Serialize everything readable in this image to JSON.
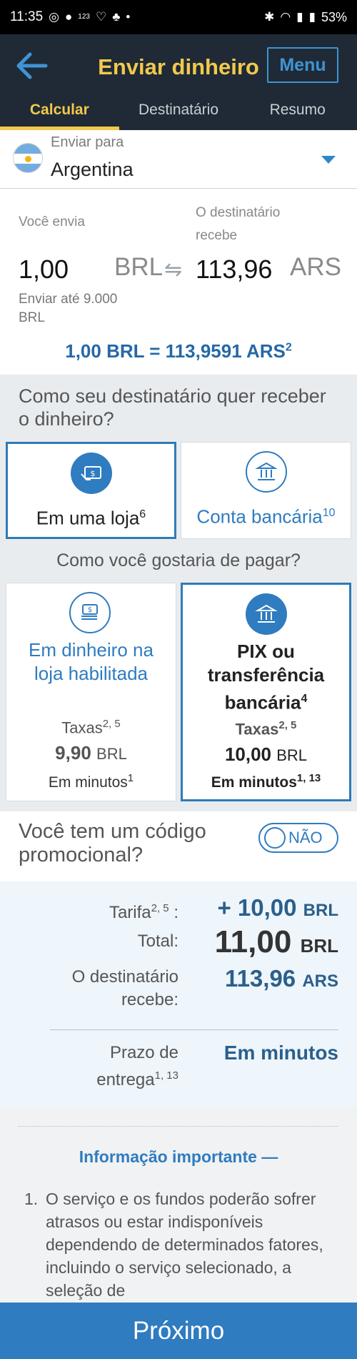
{
  "status_bar": {
    "time": "11:35",
    "hd_label": "123",
    "battery": "53%"
  },
  "header": {
    "title": "Enviar dinheiro",
    "menu_label": "Menu",
    "tabs": [
      {
        "label": "Calcular",
        "active": true
      },
      {
        "label": "Destinatário",
        "active": false
      },
      {
        "label": "Resumo",
        "active": false
      }
    ]
  },
  "country": {
    "label": "Enviar para",
    "value": "Argentina"
  },
  "amounts": {
    "send_label": "Você envia",
    "receive_label": "O destinatário recebe",
    "send_amount": "1,00",
    "send_currency": "BRL",
    "receive_amount": "113,96",
    "receive_currency": "ARS",
    "limit_text": "Enviar até  9.000 BRL",
    "rate_main": "1,00 BRL = 113,9591 ARS",
    "rate_sup": "2"
  },
  "receive_method": {
    "question": "Como seu destinatário quer receber o dinheiro?",
    "options": [
      {
        "label": "Em uma loja",
        "sup": "6",
        "selected": true,
        "icon": "cash-pickup-icon"
      },
      {
        "label": "Conta bancária",
        "sup": "10",
        "selected": false,
        "icon": "bank-icon"
      }
    ]
  },
  "pay_method": {
    "question": "Como você gostaria de pagar?",
    "options": [
      {
        "title": "Em dinheiro na loja habilitada",
        "title_sup": "",
        "fees_label": "Taxas",
        "fees_sup": "2, 5",
        "fee_amount": "9,90",
        "fee_currency": "BRL",
        "time": "Em minutos",
        "time_sup": "1",
        "selected": false,
        "icon": "cash-icon"
      },
      {
        "title": "PIX ou transferência bancária",
        "title_sup": "4",
        "fees_label": "Taxas",
        "fees_sup": "2, 5",
        "fee_amount": "10,00",
        "fee_currency": "BRL",
        "time": "Em minutos",
        "time_sup": "1, 13",
        "selected": true,
        "icon": "bank-icon"
      }
    ]
  },
  "promo": {
    "question": "Você tem um código promocional?",
    "toggle_label": "NÃO",
    "toggle_on": false
  },
  "summary": {
    "tarifa_label": "Tarifa",
    "tarifa_sup": "2, 5",
    "tarifa_colon": ":",
    "tarifa_value": "+ 10,00",
    "tarifa_currency": "BRL",
    "total_label": "Total:",
    "total_value": "11,00",
    "total_currency": "BRL",
    "receives_label": "O destinatário recebe:",
    "receives_value": "113,96",
    "receives_currency": "ARS",
    "delivery_label": "Prazo de entrega",
    "delivery_sup": "1, 13",
    "delivery_value": "Em minutos"
  },
  "info": {
    "heading": "Informação importante",
    "toggle_symbol": "—",
    "items": [
      {
        "num": "1.",
        "text": "O serviço e os fundos poderão sofrer atrasos ou estar indisponíveis dependendo de determinados fatores, incluindo o serviço selecionado, a seleção de"
      }
    ]
  },
  "next_label": "Próximo",
  "colors": {
    "header_bg": "#1f2a36",
    "accent_yellow": "#f2c94c",
    "accent_blue": "#2f7cc0",
    "rate_blue": "#2668a6"
  }
}
